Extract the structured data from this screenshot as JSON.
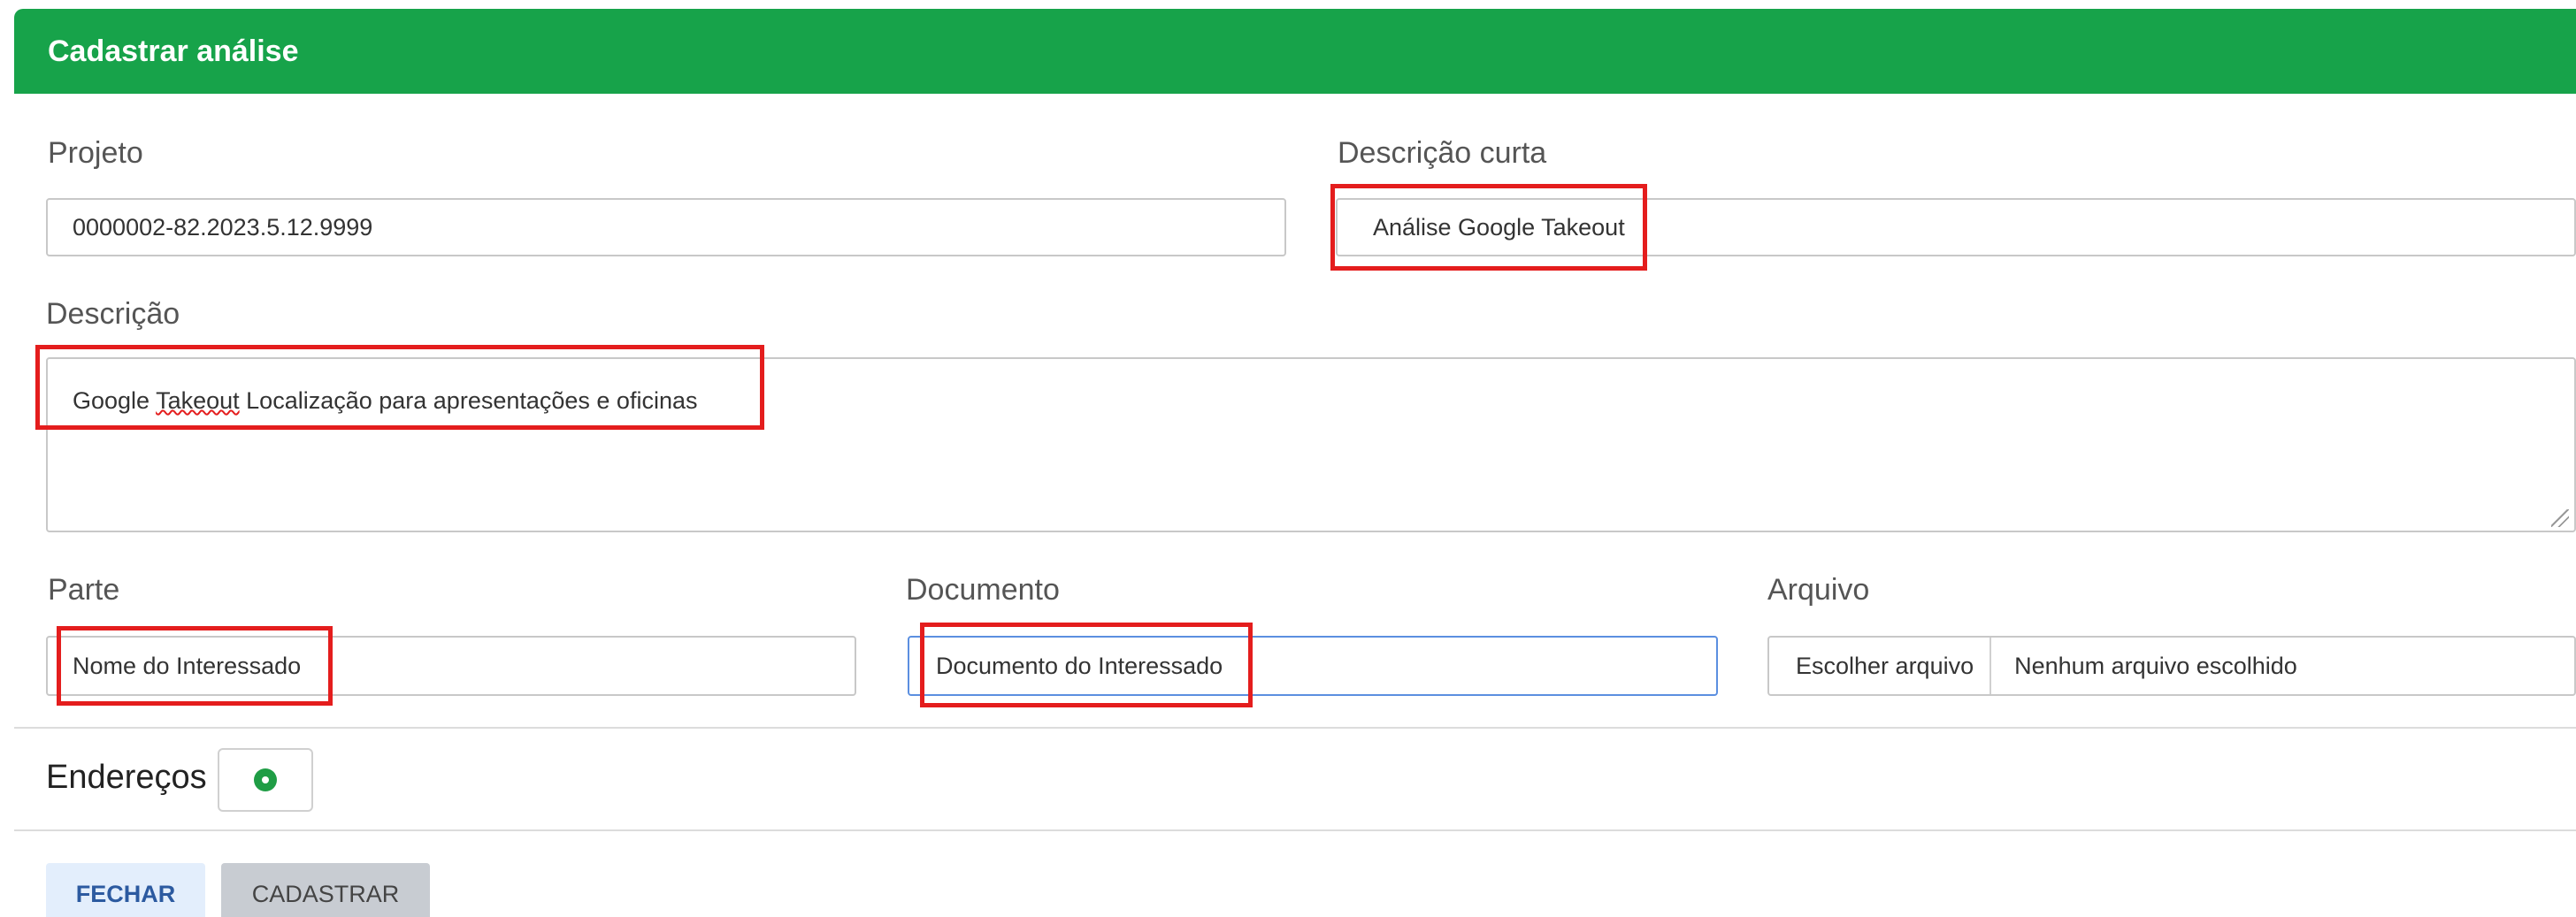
{
  "header": {
    "title": "Cadastrar análise"
  },
  "form": {
    "projeto": {
      "label": "Projeto",
      "value": "0000002-82.2023.5.12.9999"
    },
    "descricao_curta": {
      "label": "Descrição curta",
      "value": "Análise Google Takeout"
    },
    "descricao": {
      "label": "Descrição",
      "value_before": "Google ",
      "value_misspelled": "Takeout",
      "value_after": " Localização para apresentações e oficinas"
    },
    "parte": {
      "label": "Parte",
      "value": "Nome do Interessado"
    },
    "documento": {
      "label": "Documento",
      "value": "Documento do Interessado"
    },
    "arquivo": {
      "label": "Arquivo",
      "button": "Escolher arquivo",
      "status": "Nenhum arquivo escolhido"
    }
  },
  "enderecos": {
    "label": "Endereços",
    "add_icon": "add-circle-icon"
  },
  "actions": {
    "close": "FECHAR",
    "submit": "CADASTRAR"
  },
  "colors": {
    "header_bg": "#17a34a",
    "highlight": "#e41d1d",
    "focus_border": "#5b8fe0",
    "add_icon": "#1f9d45"
  }
}
